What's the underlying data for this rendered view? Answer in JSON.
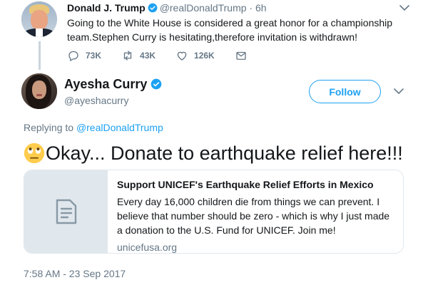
{
  "parent_tweet": {
    "author_name": "Donald J. Trump",
    "handle": "@realDonaldTrump",
    "separator": "·",
    "time": "6h",
    "text": "Going to the White House is considered a great honor for a championship team.Stephen Curry is hesitating,therefore invitation is withdrawn!",
    "actions": [
      {
        "icon": "reply-icon",
        "count": "73K"
      },
      {
        "icon": "retweet-icon",
        "count": "43K"
      },
      {
        "icon": "like-icon",
        "count": "126K"
      },
      {
        "icon": "message-icon",
        "count": ""
      }
    ]
  },
  "main_tweet": {
    "author_name": "Ayesha Curry",
    "handle": "@ayeshacurry",
    "follow_label": "Follow",
    "replying_prefix": "Replying to",
    "replying_to": "@realDonaldTrump",
    "emoji": "eye-roll-emoji",
    "text": "Okay... Donate to earthquake relief here!!!",
    "card": {
      "title": "Support UNICEF's Earthquake Relief Efforts in Mexico",
      "description": "Every day 16,000 children die from things we can prevent. I believe that number should be zero - which is why I just made a donation to the U.S. Fund for UNICEF. Join me!",
      "domain": "unicefusa.org"
    },
    "timestamp": "7:58 AM - 23 Sep 2017"
  },
  "colors": {
    "accent": "#1da1f2",
    "secondary_text": "#657786",
    "primary_text": "#14171a",
    "border": "#e1e8ed"
  }
}
